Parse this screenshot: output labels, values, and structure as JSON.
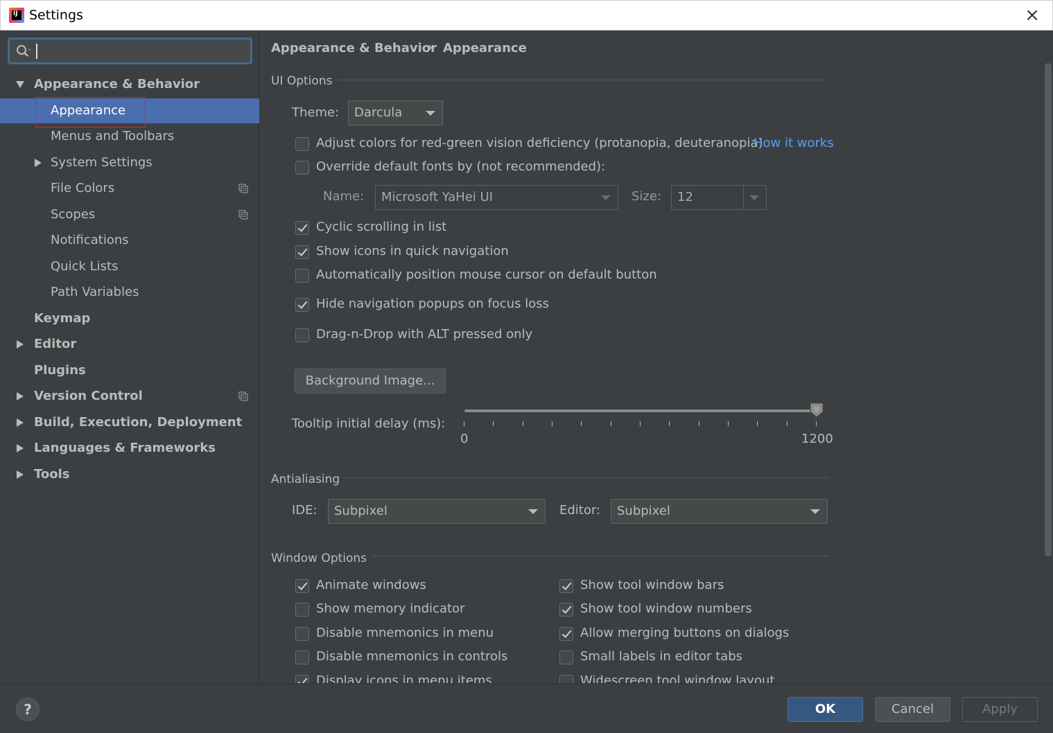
{
  "window": {
    "title": "Settings",
    "close_icon": "×"
  },
  "search": {
    "placeholder": ""
  },
  "sidebar": {
    "items": [
      {
        "label": "Appearance & Behavior",
        "bold": true,
        "expanded": true
      },
      {
        "label": "Appearance",
        "selected": true
      },
      {
        "label": "Menus and Toolbars"
      },
      {
        "label": "System Settings"
      },
      {
        "label": "File Colors"
      },
      {
        "label": "Scopes"
      },
      {
        "label": "Notifications"
      },
      {
        "label": "Quick Lists"
      },
      {
        "label": "Path Variables"
      },
      {
        "label": "Keymap",
        "bold": true
      },
      {
        "label": "Editor",
        "bold": true
      },
      {
        "label": "Plugins",
        "bold": true
      },
      {
        "label": "Version Control",
        "bold": true
      },
      {
        "label": "Build, Execution, Deployment",
        "bold": true
      },
      {
        "label": "Languages & Frameworks",
        "bold": true
      },
      {
        "label": "Tools",
        "bold": true
      }
    ]
  },
  "breadcrumb": {
    "parent": "Appearance & Behavior",
    "separator": "›",
    "current": "Appearance"
  },
  "ui_options": {
    "title": "UI Options",
    "theme_label": "Theme:",
    "theme_value": "Darcula",
    "adjust_colors": {
      "label": "Adjust colors for red-green vision deficiency (protanopia, deuteranopia)",
      "checked": false
    },
    "how_it_works": "How it works",
    "override_fonts": {
      "label": "Override default fonts by (not recommended):",
      "checked": false
    },
    "font_name_label": "Name:",
    "font_name_value": "Microsoft YaHei UI",
    "font_size_label": "Size:",
    "font_size_value": "12",
    "cyclic_scrolling": {
      "label": "Cyclic scrolling in list",
      "checked": true
    },
    "show_icons_quick_nav": {
      "label": "Show icons in quick navigation",
      "checked": true
    },
    "auto_position_mouse": {
      "label": "Automatically position mouse cursor on default button",
      "checked": false
    },
    "hide_nav_popups": {
      "label": "Hide navigation popups on focus loss",
      "checked": true
    },
    "drag_n_drop_alt": {
      "label": "Drag-n-Drop with ALT pressed only",
      "checked": false
    },
    "background_image_button": "Background Image...",
    "tooltip_label": "Tooltip initial delay (ms):",
    "tooltip_min": "0",
    "tooltip_max": "1200",
    "tooltip_value": 1200
  },
  "antialiasing": {
    "title": "Antialiasing",
    "ide_label": "IDE:",
    "ide_value": "Subpixel",
    "editor_label": "Editor:",
    "editor_value": "Subpixel"
  },
  "window_options": {
    "title": "Window Options",
    "left": [
      {
        "label": "Animate windows",
        "checked": true
      },
      {
        "label": "Show memory indicator",
        "checked": false
      },
      {
        "label": "Disable mnemonics in menu",
        "checked": false
      },
      {
        "label": "Disable mnemonics in controls",
        "checked": false
      },
      {
        "label": "Display icons in menu items",
        "checked": true
      }
    ],
    "right": [
      {
        "label": "Show tool window bars",
        "checked": true
      },
      {
        "label": "Show tool window numbers",
        "checked": true
      },
      {
        "label": "Allow merging buttons on dialogs",
        "checked": true
      },
      {
        "label": "Small labels in editor tabs",
        "checked": false
      },
      {
        "label": "Widescreen tool window layout",
        "checked": false
      }
    ]
  },
  "footer": {
    "help": "?",
    "ok": "OK",
    "cancel": "Cancel",
    "apply": "Apply"
  },
  "colors": {
    "selection": "#4b6eaf",
    "link": "#589df6",
    "background": "#3c3f41",
    "outline": "#e02222"
  }
}
